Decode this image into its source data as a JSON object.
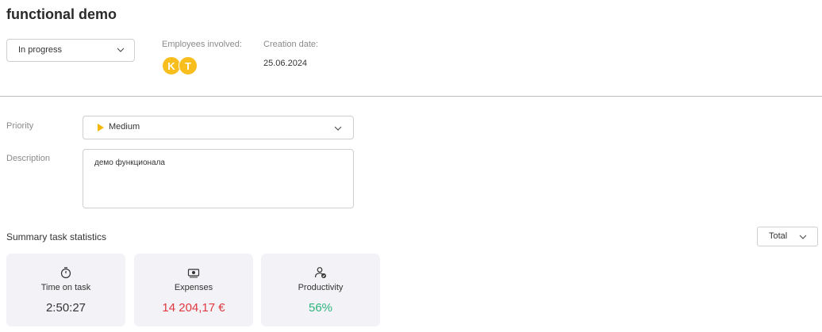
{
  "header": {
    "title": "functional demo"
  },
  "status": {
    "selected": "In progress"
  },
  "meta": {
    "employees_label": "Employees involved:",
    "employees": [
      {
        "initial": "K"
      },
      {
        "initial": "T"
      }
    ],
    "creation_label": "Creation date:",
    "creation_date": "25.06.2024"
  },
  "priority": {
    "label": "Priority",
    "value": "Medium",
    "color": "#f5b800"
  },
  "description": {
    "label": "Description",
    "value": "демо функционала"
  },
  "summary": {
    "title": "Summary task statistics",
    "period": "Total",
    "cards": [
      {
        "icon": "stopwatch-icon",
        "label": "Time on task",
        "value": "2:50:27",
        "color": "#333333"
      },
      {
        "icon": "money-icon",
        "label": "Expenses",
        "value": "14 204,17 €",
        "color": "#e0373f"
      },
      {
        "icon": "user-check-icon",
        "label": "Productivity",
        "value": "56%",
        "color": "#2eb47c"
      }
    ]
  },
  "colors": {
    "avatar": "#f7be1e",
    "divider": "#bdbdbd"
  }
}
